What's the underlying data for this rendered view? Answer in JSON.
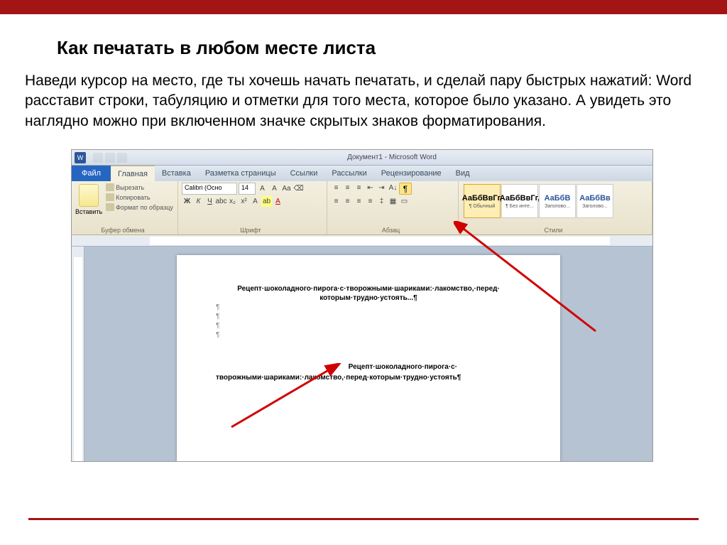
{
  "slide": {
    "title": "Как печатать в любом месте листа",
    "description": "Наведи курсор на место, где ты хочешь начать печатать, и сделай пару быстрых нажатий: Word расставит строки, табуляцию и отметки для того места, которое было указано. А увидеть это наглядно можно при включенном значке скрытых знаков форматирования."
  },
  "word": {
    "docTitle": "Документ1 - Microsoft Word",
    "tabs": {
      "file": "Файл",
      "home": "Главная",
      "insert": "Вставка",
      "layout": "Разметка страницы",
      "refs": "Ссылки",
      "mail": "Рассылки",
      "review": "Рецензирование",
      "view": "Вид"
    },
    "clipboard": {
      "paste": "Вставить",
      "cut": "Вырезать",
      "copy": "Копировать",
      "formatPainter": "Формат по образцу",
      "groupLabel": "Буфер обмена"
    },
    "font": {
      "name": "Calibri (Осно",
      "size": "14",
      "groupLabel": "Шрифт"
    },
    "paragraph": {
      "groupLabel": "Абзац",
      "pilcrow": "¶"
    },
    "styles": {
      "sample": "АаБбВвГг,",
      "sampleHeading": "АаБбВ",
      "sampleH2": "АаБбВв",
      "normal": "¶ Обычный",
      "noSpacing": "¶ Без инте...",
      "heading1": "Заголово...",
      "heading2": "Заголово...",
      "groupLabel": "Стили"
    },
    "document": {
      "line1": "Рецепт·шоколадного·пирога·с·творожными·шариками:·лакомство,·перед·",
      "line2": "которым·трудно·устоять...¶",
      "rightChunk": "Рецепт·шоколадного·пирога·с·",
      "bottomLine": "творожными·шариками:·лакомство,·перед·которым·трудно·устоять¶",
      "arrow": "→"
    }
  }
}
